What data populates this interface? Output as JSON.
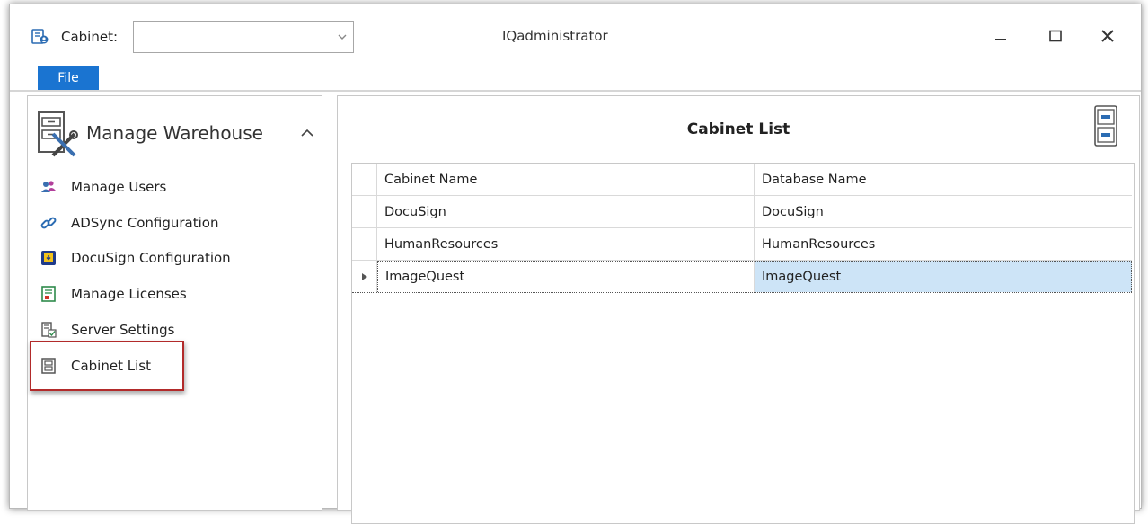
{
  "titlebar": {
    "cabinet_label": "Cabinet:",
    "cabinet_value": "",
    "window_title": "IQadministrator",
    "minimize": "–",
    "maximize": "☐",
    "close": "✕"
  },
  "ribbon": {
    "file_tab": "File"
  },
  "nav": {
    "header": "Manage Warehouse",
    "items": [
      {
        "label": "Manage Users",
        "icon": "users-icon"
      },
      {
        "label": "ADSync Configuration",
        "icon": "link-icon"
      },
      {
        "label": "DocuSign Configuration",
        "icon": "docusign-icon"
      },
      {
        "label": "Manage Licenses",
        "icon": "license-icon"
      },
      {
        "label": "Server Settings",
        "icon": "server-settings-icon"
      },
      {
        "label": "Cabinet List",
        "icon": "cabinet-icon"
      }
    ]
  },
  "content": {
    "title": "Cabinet List",
    "columns": [
      "Cabinet Name",
      "Database Name"
    ],
    "rows": [
      [
        "DocuSign",
        "DocuSign"
      ],
      [
        "HumanResources",
        "HumanResources"
      ],
      [
        "ImageQuest",
        "ImageQuest"
      ]
    ],
    "selected_row": 2
  },
  "colors": {
    "accent": "#1a74d1",
    "highlight_border": "#b22a2a",
    "selection": "#cde4f7"
  }
}
